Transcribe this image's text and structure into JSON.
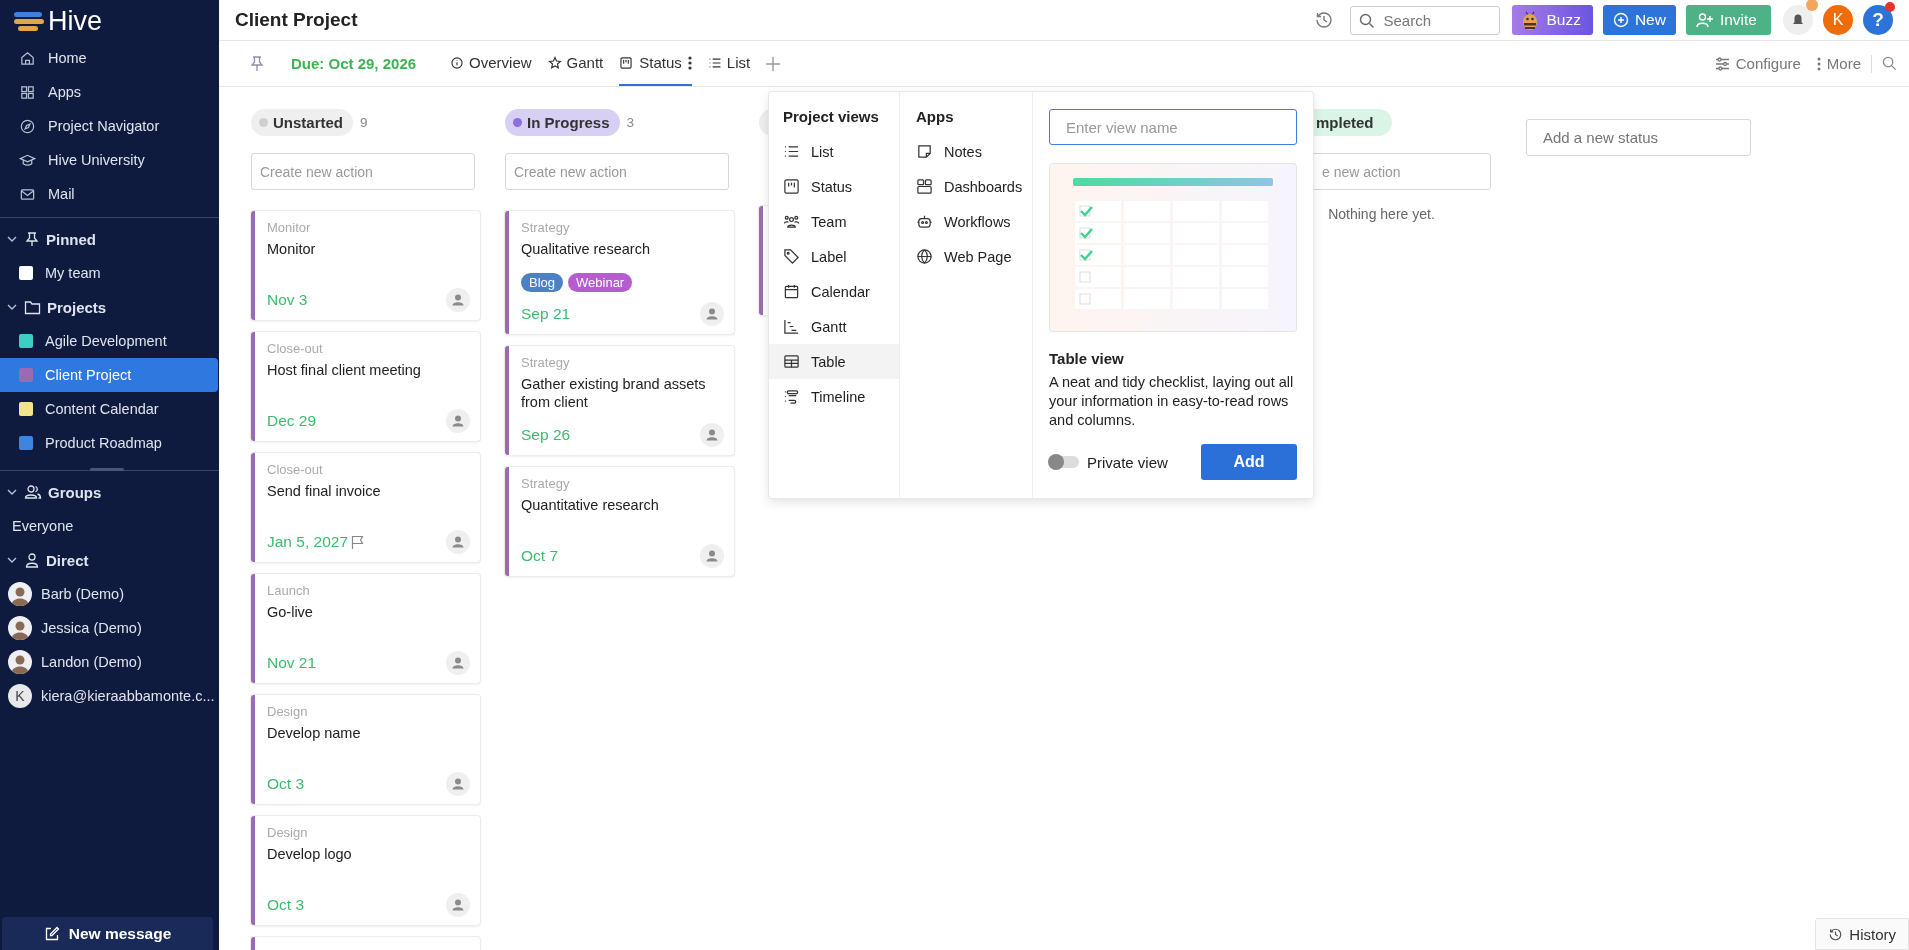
{
  "sidebar": {
    "logo": "Hive",
    "nav": [
      {
        "label": "Home"
      },
      {
        "label": "Apps"
      },
      {
        "label": "Project Navigator"
      },
      {
        "label": "Hive University"
      },
      {
        "label": "Mail"
      }
    ],
    "pinned": {
      "title": "Pinned",
      "expanded": true,
      "items": [
        {
          "label": "My team",
          "color": "#ffffff",
          "selected": false
        }
      ]
    },
    "projects": {
      "title": "Projects",
      "expanded": true,
      "items": [
        {
          "label": "Agile Development",
          "color": "#3ecfc4",
          "selected": false
        },
        {
          "label": "Client Project",
          "color": "#9a6bb2",
          "selected": true
        },
        {
          "label": "Content Calendar",
          "color": "#f2e58c",
          "selected": false
        },
        {
          "label": "Product Roadmap",
          "color": "#3d86e0",
          "selected": false
        }
      ]
    },
    "groups": {
      "title": "Groups",
      "expanded": true,
      "items": [
        {
          "label": "Everyone"
        }
      ]
    },
    "direct": {
      "title": "Direct",
      "expanded": true,
      "items": [
        {
          "name": "Barb (Demo)",
          "kind": "avatar"
        },
        {
          "name": "Jessica (Demo)",
          "kind": "avatar"
        },
        {
          "name": "Landon (Demo)",
          "kind": "avatar"
        },
        {
          "name": "kiera@kieraabbamonte.c...",
          "kind": "initial",
          "initial": "K"
        }
      ]
    },
    "new_message": "New message"
  },
  "header": {
    "title": "Client Project",
    "search": {
      "placeholder": "Search"
    },
    "buttons": [
      {
        "label": "Buzz",
        "kind": "buzz"
      },
      {
        "label": "New",
        "kind": "new"
      },
      {
        "label": "Invite",
        "kind": "invite"
      }
    ],
    "notifications": {
      "unread": true
    },
    "user_initial": "K",
    "help": {
      "label": "?",
      "alert": true
    }
  },
  "tabbar": {
    "due": "Due: Oct 29, 2026",
    "tabs": [
      {
        "label": "Overview",
        "selected": false
      },
      {
        "label": "Gantt",
        "selected": false
      },
      {
        "label": "Status",
        "selected": true
      },
      {
        "label": "List",
        "selected": false
      }
    ],
    "actions": [
      "Configure",
      "More"
    ]
  },
  "board": {
    "columns": [
      {
        "kind": "full",
        "name": "Unstarted",
        "count": "9",
        "color": "#cfcfcf",
        "input_placeholder": "Create new action",
        "cards": [
          {
            "kind": "task",
            "category": "Monitor",
            "title": "Monitor",
            "date": "Nov 3",
            "flag": false
          },
          {
            "kind": "task",
            "category": "Close-out",
            "title": "Host final client meeting",
            "date": "Dec 29",
            "flag": false
          },
          {
            "kind": "task",
            "category": "Close-out",
            "title": "Send final invoice",
            "date": "Jan 5, 2027",
            "flag": true
          },
          {
            "kind": "task",
            "category": "Launch",
            "title": "Go-live",
            "date": "Nov 21",
            "flag": false
          },
          {
            "kind": "task",
            "category": "Design",
            "title": "Develop name",
            "date": "Oct 3",
            "flag": false
          },
          {
            "kind": "task",
            "category": "Design",
            "title": "Develop logo",
            "date": "Oct 3",
            "flag": false
          },
          {
            "kind": "cut"
          }
        ]
      },
      {
        "kind": "full",
        "name": "In Progress",
        "count": "3",
        "color": "#8b6fe0",
        "input_placeholder": "Create new action",
        "cards": [
          {
            "kind": "task",
            "category": "Strategy",
            "title": "Qualitative research",
            "tags": [
              {
                "label": "Blog",
                "color": "#4a82c4"
              },
              {
                "label": "Webinar",
                "color": "#b65ccf"
              }
            ],
            "date": "Sep 21",
            "flag": false
          },
          {
            "kind": "task",
            "category": "Strategy",
            "title": "Gather existing brand assets from client",
            "date": "Sep 26",
            "flag": false
          },
          {
            "kind": "task",
            "category": "Strategy",
            "title": "Quantitative research",
            "date": "Oct 7",
            "flag": false
          }
        ]
      },
      {
        "kind": "covered",
        "color": "#eeeeee"
      },
      {
        "kind": "cut",
        "name": "mpleted",
        "color": "#daf5e5",
        "input_placeholder": "e new action",
        "empty_text": "Nothing here yet."
      }
    ],
    "add_status": {
      "placeholder": "Add a new status"
    }
  },
  "views_menu": {
    "project_title": "Project views",
    "views": [
      {
        "label": "List",
        "selected": false
      },
      {
        "label": "Status",
        "selected": false
      },
      {
        "label": "Team",
        "selected": false
      },
      {
        "label": "Label",
        "selected": false
      },
      {
        "label": "Calendar",
        "selected": false
      },
      {
        "label": "Gantt",
        "selected": false
      },
      {
        "label": "Table",
        "selected": true
      },
      {
        "label": "Timeline",
        "selected": false
      }
    ],
    "apps_title": "Apps",
    "apps": [
      {
        "label": "Notes"
      },
      {
        "label": "Dashboards"
      },
      {
        "label": "Workflows"
      },
      {
        "label": "Web Page"
      }
    ],
    "name_field": {
      "placeholder": "Enter view name"
    },
    "preview_title": "Table view",
    "preview_text": "A neat and tidy checklist, laying out all your information in easy-to-read rows and columns.",
    "private_view": {
      "label": "Private view",
      "on": false
    },
    "add_button": "Add"
  },
  "history": "History"
}
